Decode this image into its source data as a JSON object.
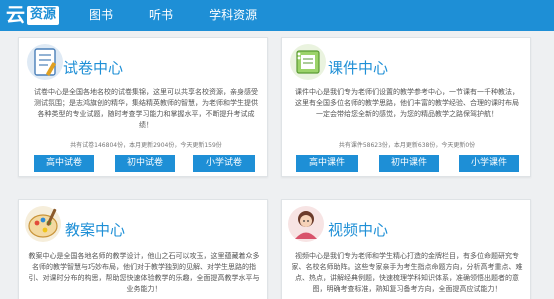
{
  "header": {
    "logo_cloud": "云",
    "logo_box": "资源",
    "nav": [
      "图书",
      "听书",
      "学科资源"
    ]
  },
  "cards": {
    "exam": {
      "title": "试卷中心",
      "desc": "试卷中心是全国各地名校的试卷集锦，这里可以共享名校资源，亲身感受测试氛围；是志鸿旗创的精华，集结精英教师的智慧，为老师和学生提供各种类型的专业试题，随时考查学习能力和掌握水平，不断提升考试成绩！",
      "stats": "共有试卷146804份，本月更新2904份，今天更新159份",
      "buttons": [
        "高中试卷",
        "初中试卷",
        "小学试卷"
      ]
    },
    "courseware": {
      "title": "课件中心",
      "desc": "课件中心是我们专为老师们设置的教学参考中心，一节课有一千种教法，这里有全国多位名师的教学思路，他们丰富的教学经验、合理的课时布局一定会带给您全新的感觉，为您的精品教学之路保驾护航！",
      "stats": "共有课件58623份，本月更新638份，今天更新0份",
      "buttons": [
        "高中课件",
        "初中课件",
        "小学课件"
      ]
    },
    "lesson": {
      "title": "教案中心",
      "desc": "教案中心是全国各地名师的教学设计，他山之石可以攻玉，这里蕴藏着众多名师的教学智慧与巧妙布局，他们对于教学独到的见解、对学生思路的指引、对课时分布的构思，帮助您快速体验教学的乐趣，全面提高教学水平与业务能力！"
    },
    "video": {
      "title": "视频中心",
      "desc": "视频中心是我们专为老师和学生精心打造的金牌栏目，有多位命题研究专家、名校名师助阵。这些专家亲手为考生指点命题方向，分析高考重点、难点、热点，讲解经典例题，快速梳理学科知识体系，准确领悟出题者的意图，明确考查标准，熟知复习备考方向，全面提高应试能力！"
    }
  },
  "colors": {
    "accent": "#1e8fd6",
    "background": "#eef0f2"
  },
  "icons": [
    "exam-paper-icon",
    "courseware-notebook-icon",
    "lesson-plan-palette-icon",
    "video-teacher-icon"
  ]
}
